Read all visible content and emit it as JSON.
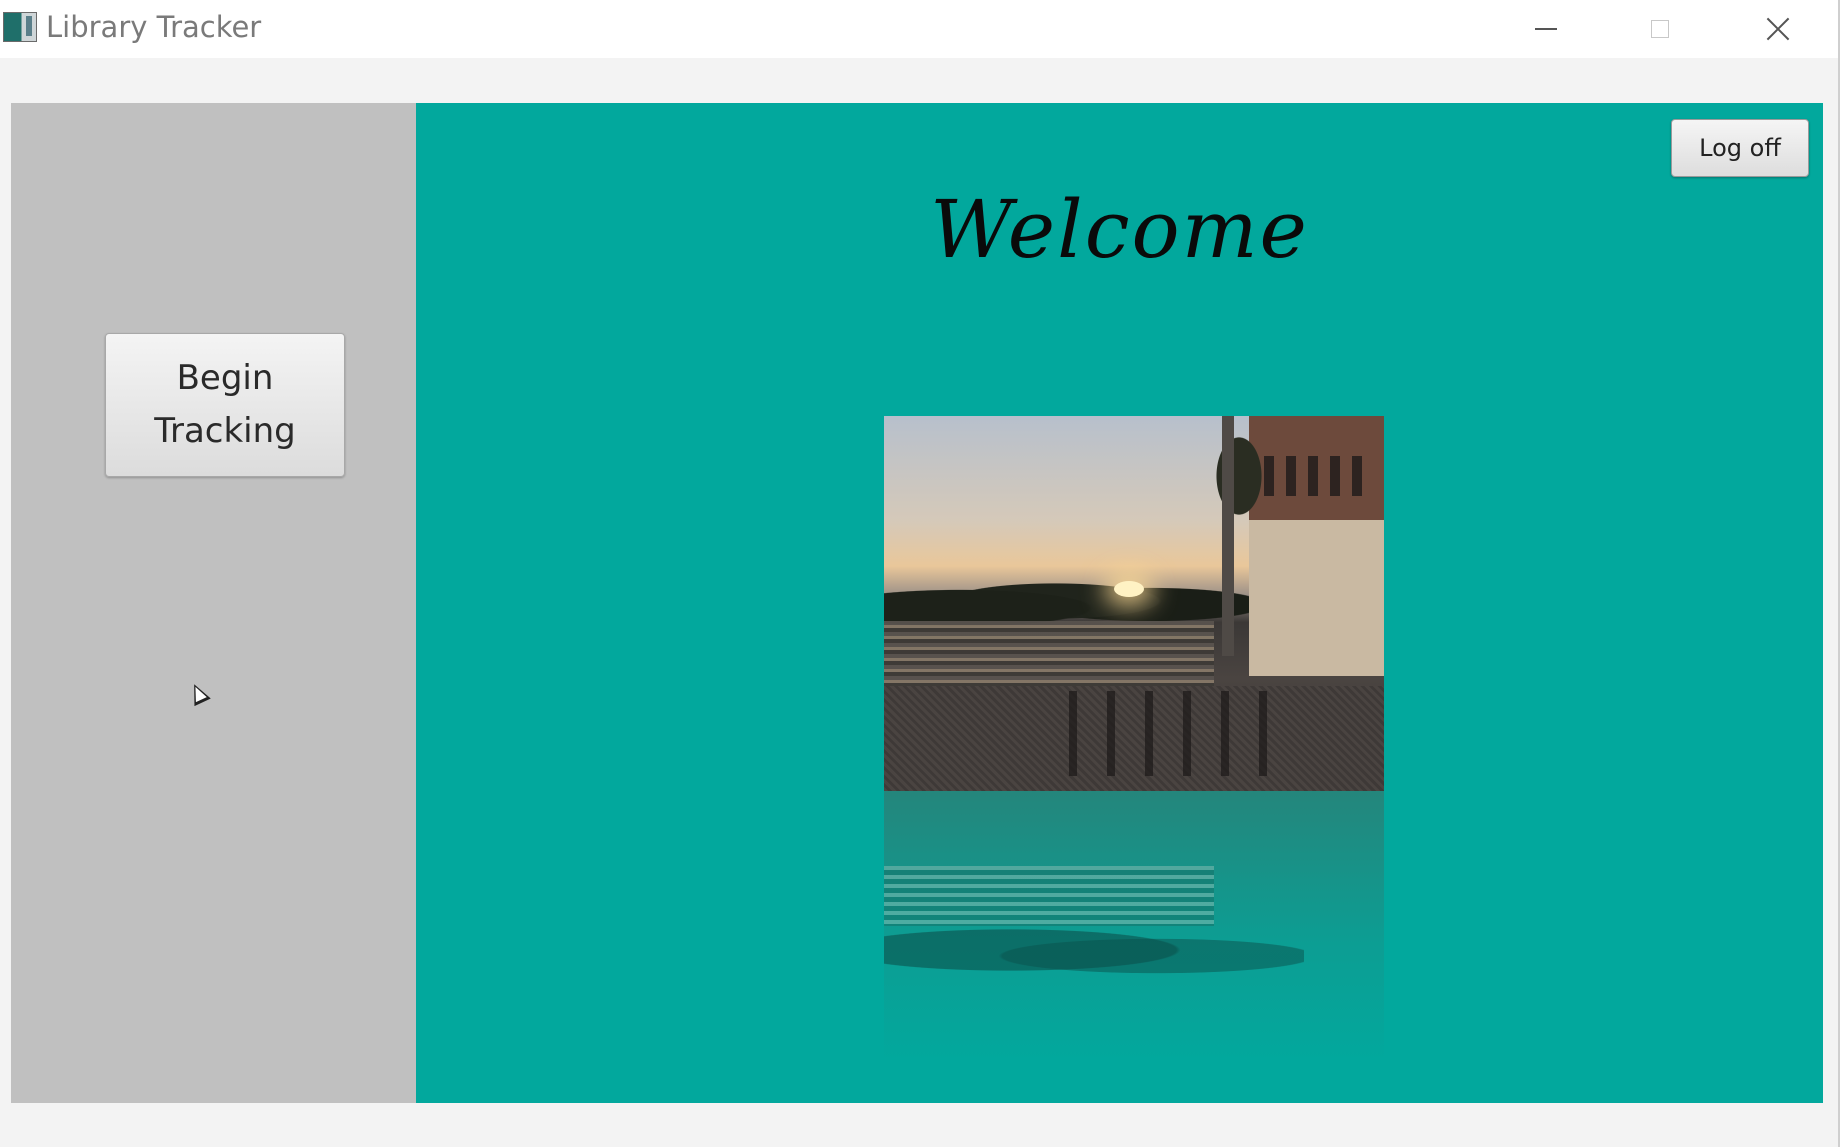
{
  "window": {
    "title": "Library Tracker",
    "icons": {
      "app": "app-icon",
      "minimize": "minimize-icon",
      "maximize": "maximize-icon",
      "close": "close-icon"
    }
  },
  "sidebar": {
    "begin_tracking_label": "Begin Tracking"
  },
  "main": {
    "logoff_label": "Log off",
    "heading": "Welcome",
    "background_color": "#02a89d"
  },
  "colors": {
    "sidebar": "#c0c0c0",
    "accent": "#02a89d"
  }
}
